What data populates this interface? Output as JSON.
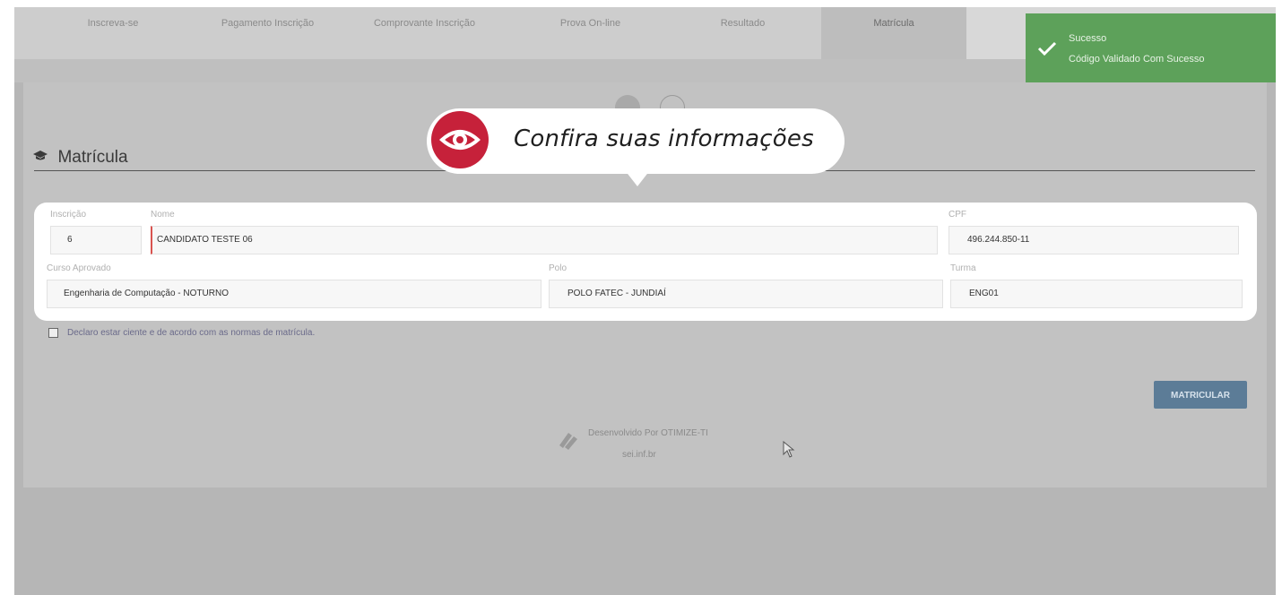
{
  "tabs": [
    {
      "label": "Inscreva-se"
    },
    {
      "label": "Pagamento Inscrição"
    },
    {
      "label": "Comprovante Inscrição"
    },
    {
      "label": "Prova On-line"
    },
    {
      "label": "Resultado"
    },
    {
      "label": "Matrícula"
    }
  ],
  "section": {
    "title": "Matrícula",
    "icon": "graduation-cap-icon"
  },
  "tooltip": {
    "text": "Confira suas informações",
    "icon": "eye-icon",
    "color": "#c6213a"
  },
  "form": {
    "inscricao": {
      "label": "Inscrição",
      "value": "6"
    },
    "nome": {
      "label": "Nome",
      "value": "CANDIDATO TESTE 06"
    },
    "cpf": {
      "label": "CPF",
      "value": "496.244.850-11"
    },
    "curso": {
      "label": "Curso Aprovado",
      "value": "Engenharia de Computação - NOTURNO"
    },
    "polo": {
      "label": "Polo",
      "value": "POLO FATEC - JUNDIAÍ"
    },
    "turma": {
      "label": "Turma",
      "value": "ENG01"
    }
  },
  "agree": {
    "label": "Declaro estar ciente e de acordo com as normas de matrícula."
  },
  "button": {
    "label": "MATRICULAR",
    "color": "#5c7c97"
  },
  "footer": {
    "developed_by": "Desenvolvido Por OTIMIZE-TI",
    "url": "sei.inf.br"
  },
  "toast": {
    "title": "Sucesso",
    "message": "Código Validado Com Sucesso",
    "color": "#5da15a",
    "icon": "check-icon"
  }
}
